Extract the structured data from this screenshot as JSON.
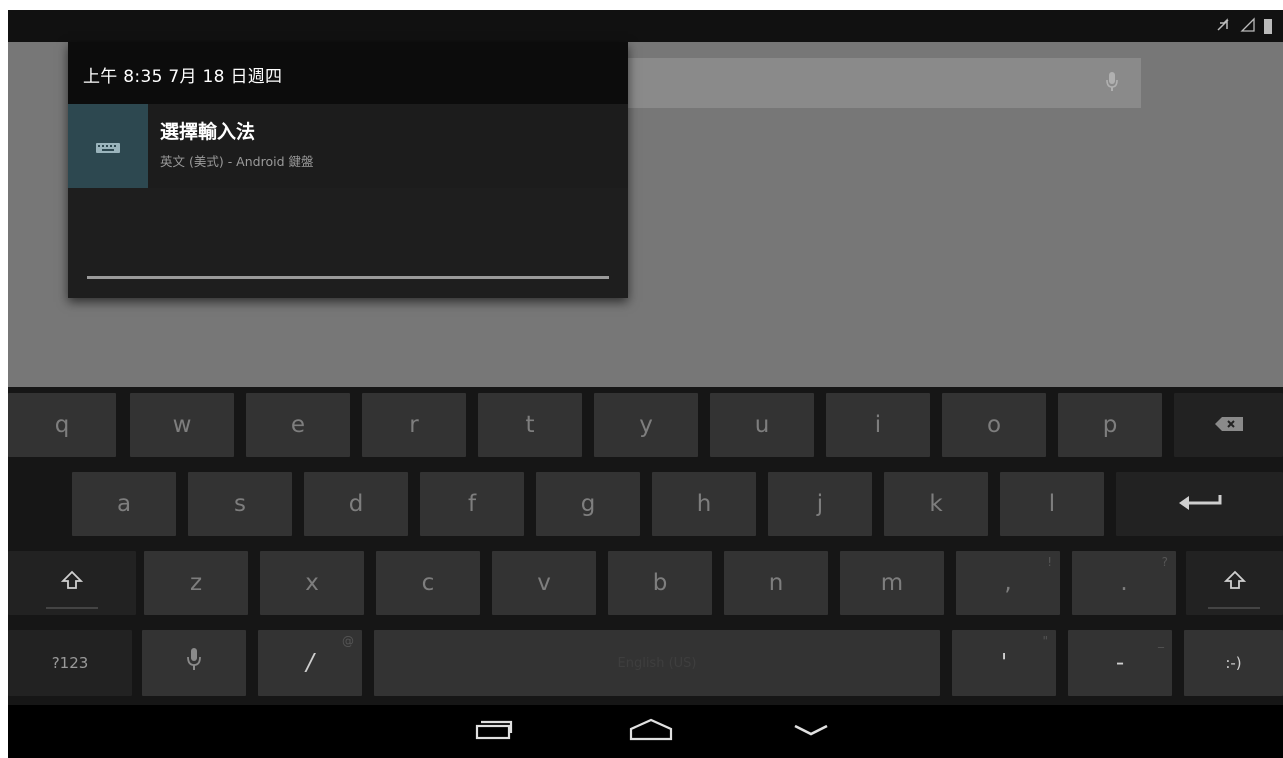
{
  "colors": {
    "accent_icon_bg": "#2d4850",
    "panel_bg": "#1e1e1e",
    "key_bg": "#333333",
    "keyboard_bg": "#161616"
  },
  "notification": {
    "clock": "上午 8:35 7月 18 日週四",
    "title": "選擇輸入法",
    "subtitle": "英文 (美式) - Android 鍵盤",
    "icon": "keyboard-icon"
  },
  "keyboard": {
    "row1": [
      "q",
      "w",
      "e",
      "r",
      "t",
      "y",
      "u",
      "i",
      "o",
      "p"
    ],
    "row2": [
      "a",
      "s",
      "d",
      "f",
      "g",
      "h",
      "j",
      "k",
      "l"
    ],
    "row3": [
      "z",
      "x",
      "c",
      "v",
      "b",
      "n",
      "m",
      ",",
      "."
    ],
    "row3_hints": {
      "comma": "!",
      "period": "?"
    },
    "symbols_label": "?123",
    "slash_label": "/",
    "slash_hint": "@",
    "space_label": "English (US)",
    "apostrophe_label": "'",
    "apostrophe_hint": "\"",
    "dash_label": "-",
    "dash_hint": "_",
    "smiley_label": ":-)"
  },
  "icons": {
    "backspace": "backspace-icon",
    "enter": "enter-icon",
    "shift": "shift-icon",
    "mic": "microphone-icon",
    "back": "back-icon",
    "home": "home-icon",
    "recents": "recent-apps-icon"
  }
}
